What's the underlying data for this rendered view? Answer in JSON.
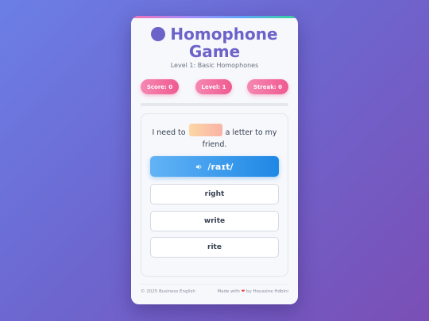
{
  "header": {
    "title_line1": "Homophone",
    "title_line2": "Game",
    "icon": "blob-icon",
    "subtitle": "Level 1: Basic Homophones"
  },
  "stats": {
    "score_label": "Score: 0",
    "level_label": "Level: 1",
    "streak_label": "Streak: 0"
  },
  "progress": {
    "fraction": 0
  },
  "question": {
    "before_blank": "I need to",
    "after_blank": "a letter to my friend.",
    "pronunciation": "/raɪt/",
    "sound_icon": "speaker-icon"
  },
  "options": [
    "right",
    "write",
    "rite"
  ],
  "footer": {
    "copyright": "© 2025 Business English",
    "made_with_prefix": "Made with",
    "made_with_suffix": "by Houssine Hdbini",
    "heart_icon": "heart-icon"
  },
  "colors": {
    "accent": "#6c63c9",
    "pill": "#ef5b8f",
    "sound_button": "#1e88e5"
  }
}
